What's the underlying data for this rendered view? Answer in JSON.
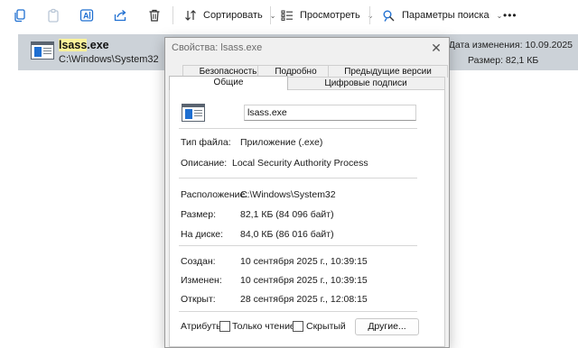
{
  "toolbar": {
    "sort_label": "Сортировать",
    "view_label": "Просмотреть",
    "search_options_label": "Параметры поиска",
    "more_label": "•••",
    "icons": [
      "copy-icon",
      "paste-icon",
      "rename-icon",
      "share-icon",
      "delete-icon",
      "sort-icon",
      "view-icon",
      "search-options-icon",
      "more-icon"
    ]
  },
  "file_row": {
    "name_highlight": "lsass",
    "name_rest": ".exe",
    "path": "C:\\Windows\\System32",
    "date_modified": "Дата изменения: 10.09.2025",
    "size": "Размер: 82,1 КБ"
  },
  "dialog": {
    "title": "Свойства: lsass.exe",
    "close_label": "✕",
    "tabs_row1": [
      "Безопасность",
      "Подробно",
      "Предыдущие версии"
    ],
    "tabs_row2": [
      "Общие",
      "Цифровые подписи"
    ],
    "active_tab": "Общие",
    "file_name_value": "lsass.exe",
    "type_label": "Тип файла:",
    "type_value": "Приложение (.exe)",
    "desc_label": "Описание:",
    "desc_value": "Local Security Authority Process",
    "location_label": "Расположение:",
    "location_value": "C:\\Windows\\System32",
    "size_label": "Размер:",
    "size_value": "82,1 КБ (84 096 байт)",
    "disk_label": "На диске:",
    "disk_value": "84,0 КБ (86 016 байт)",
    "created_label": "Создан:",
    "created_value": "10 сентября 2025 г., 10:39:15",
    "modified_label": "Изменен:",
    "modified_value": "10 сентября 2025 г., 10:39:15",
    "opened_label": "Открыт:",
    "opened_value": "28 сентября 2025 г., 12:08:15",
    "attributes_label": "Атрибуты:",
    "readonly_label": "Только чтение",
    "hidden_label": "Скрытый",
    "other_button": "Другие..."
  },
  "colors": {
    "accent": "#1f6fd1",
    "selected_row": "#ccd2d8",
    "search_highlight": "#fbf39a",
    "dialog_bg": "#f0f0f0"
  }
}
